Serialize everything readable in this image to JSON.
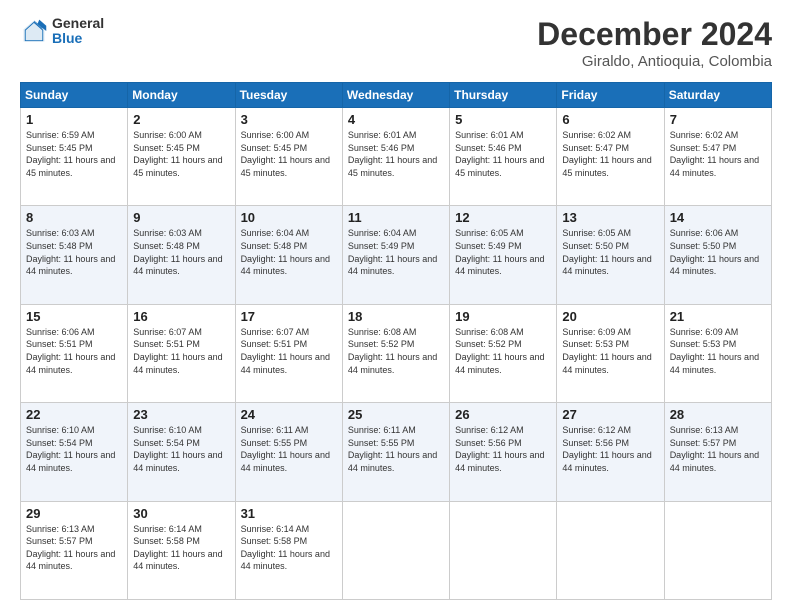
{
  "logo": {
    "general": "General",
    "blue": "Blue"
  },
  "title": "December 2024",
  "subtitle": "Giraldo, Antioquia, Colombia",
  "days_of_week": [
    "Sunday",
    "Monday",
    "Tuesday",
    "Wednesday",
    "Thursday",
    "Friday",
    "Saturday"
  ],
  "weeks": [
    [
      {
        "day": "1",
        "sunrise": "6:59 AM",
        "sunset": "5:45 PM",
        "daylight": "11 hours and 45 minutes."
      },
      {
        "day": "2",
        "sunrise": "6:00 AM",
        "sunset": "5:45 PM",
        "daylight": "11 hours and 45 minutes."
      },
      {
        "day": "3",
        "sunrise": "6:00 AM",
        "sunset": "5:45 PM",
        "daylight": "11 hours and 45 minutes."
      },
      {
        "day": "4",
        "sunrise": "6:01 AM",
        "sunset": "5:46 PM",
        "daylight": "11 hours and 45 minutes."
      },
      {
        "day": "5",
        "sunrise": "6:01 AM",
        "sunset": "5:46 PM",
        "daylight": "11 hours and 45 minutes."
      },
      {
        "day": "6",
        "sunrise": "6:02 AM",
        "sunset": "5:47 PM",
        "daylight": "11 hours and 45 minutes."
      },
      {
        "day": "7",
        "sunrise": "6:02 AM",
        "sunset": "5:47 PM",
        "daylight": "11 hours and 44 minutes."
      }
    ],
    [
      {
        "day": "8",
        "sunrise": "6:03 AM",
        "sunset": "5:48 PM",
        "daylight": "11 hours and 44 minutes."
      },
      {
        "day": "9",
        "sunrise": "6:03 AM",
        "sunset": "5:48 PM",
        "daylight": "11 hours and 44 minutes."
      },
      {
        "day": "10",
        "sunrise": "6:04 AM",
        "sunset": "5:48 PM",
        "daylight": "11 hours and 44 minutes."
      },
      {
        "day": "11",
        "sunrise": "6:04 AM",
        "sunset": "5:49 PM",
        "daylight": "11 hours and 44 minutes."
      },
      {
        "day": "12",
        "sunrise": "6:05 AM",
        "sunset": "5:49 PM",
        "daylight": "11 hours and 44 minutes."
      },
      {
        "day": "13",
        "sunrise": "6:05 AM",
        "sunset": "5:50 PM",
        "daylight": "11 hours and 44 minutes."
      },
      {
        "day": "14",
        "sunrise": "6:06 AM",
        "sunset": "5:50 PM",
        "daylight": "11 hours and 44 minutes."
      }
    ],
    [
      {
        "day": "15",
        "sunrise": "6:06 AM",
        "sunset": "5:51 PM",
        "daylight": "11 hours and 44 minutes."
      },
      {
        "day": "16",
        "sunrise": "6:07 AM",
        "sunset": "5:51 PM",
        "daylight": "11 hours and 44 minutes."
      },
      {
        "day": "17",
        "sunrise": "6:07 AM",
        "sunset": "5:51 PM",
        "daylight": "11 hours and 44 minutes."
      },
      {
        "day": "18",
        "sunrise": "6:08 AM",
        "sunset": "5:52 PM",
        "daylight": "11 hours and 44 minutes."
      },
      {
        "day": "19",
        "sunrise": "6:08 AM",
        "sunset": "5:52 PM",
        "daylight": "11 hours and 44 minutes."
      },
      {
        "day": "20",
        "sunrise": "6:09 AM",
        "sunset": "5:53 PM",
        "daylight": "11 hours and 44 minutes."
      },
      {
        "day": "21",
        "sunrise": "6:09 AM",
        "sunset": "5:53 PM",
        "daylight": "11 hours and 44 minutes."
      }
    ],
    [
      {
        "day": "22",
        "sunrise": "6:10 AM",
        "sunset": "5:54 PM",
        "daylight": "11 hours and 44 minutes."
      },
      {
        "day": "23",
        "sunrise": "6:10 AM",
        "sunset": "5:54 PM",
        "daylight": "11 hours and 44 minutes."
      },
      {
        "day": "24",
        "sunrise": "6:11 AM",
        "sunset": "5:55 PM",
        "daylight": "11 hours and 44 minutes."
      },
      {
        "day": "25",
        "sunrise": "6:11 AM",
        "sunset": "5:55 PM",
        "daylight": "11 hours and 44 minutes."
      },
      {
        "day": "26",
        "sunrise": "6:12 AM",
        "sunset": "5:56 PM",
        "daylight": "11 hours and 44 minutes."
      },
      {
        "day": "27",
        "sunrise": "6:12 AM",
        "sunset": "5:56 PM",
        "daylight": "11 hours and 44 minutes."
      },
      {
        "day": "28",
        "sunrise": "6:13 AM",
        "sunset": "5:57 PM",
        "daylight": "11 hours and 44 minutes."
      }
    ],
    [
      {
        "day": "29",
        "sunrise": "6:13 AM",
        "sunset": "5:57 PM",
        "daylight": "11 hours and 44 minutes."
      },
      {
        "day": "30",
        "sunrise": "6:14 AM",
        "sunset": "5:58 PM",
        "daylight": "11 hours and 44 minutes."
      },
      {
        "day": "31",
        "sunrise": "6:14 AM",
        "sunset": "5:58 PM",
        "daylight": "11 hours and 44 minutes."
      },
      null,
      null,
      null,
      null
    ]
  ]
}
